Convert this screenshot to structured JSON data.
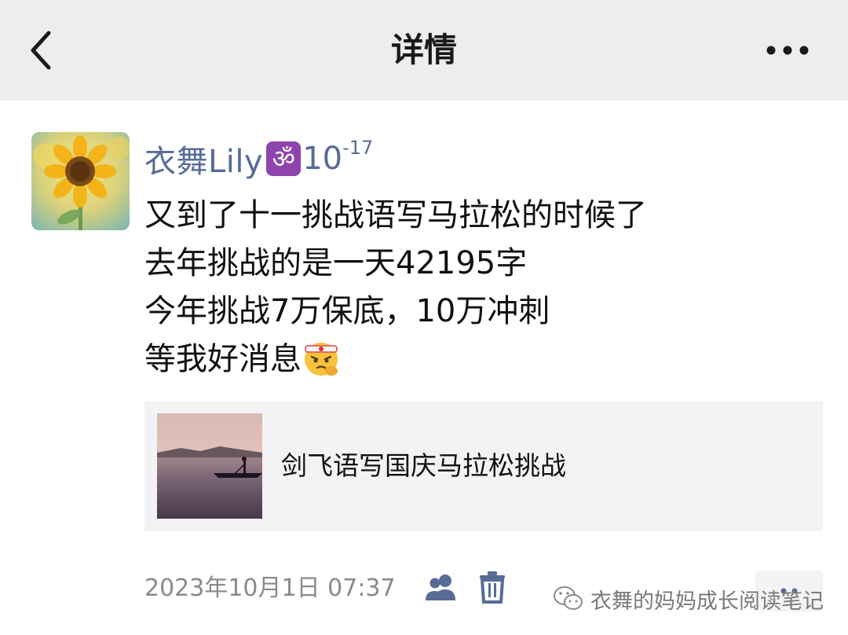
{
  "nav": {
    "title": "详情",
    "back_icon": "chevron-left-icon",
    "more_icon": "more-dots-icon"
  },
  "post": {
    "username": "衣舞Lily",
    "badge_glyph": "ॐ",
    "name_suffix": "10",
    "name_superscript": "-17",
    "lines": [
      "又到了十一挑战语写马拉松的时候了",
      "去年挑战的是一天42195字",
      "今年挑战7万保底，10万冲刺",
      "等我好消息"
    ],
    "emoji": "determined-face-headband",
    "link_card": {
      "title": "剑飞语写国庆马拉松挑战"
    },
    "timestamp": "2023年10月1日 07:37"
  },
  "footer": {
    "visibility_icon": "people-icon",
    "delete_icon": "trash-icon",
    "comment_icon": "comment-icon",
    "watermark": "衣舞的妈妈成长阅读笔记"
  },
  "colors": {
    "nav_bg": "#ededed",
    "username": "#576b95",
    "badge": "#8e44ad",
    "card_bg": "#f3f3f5",
    "muted": "#8a8a8a"
  }
}
